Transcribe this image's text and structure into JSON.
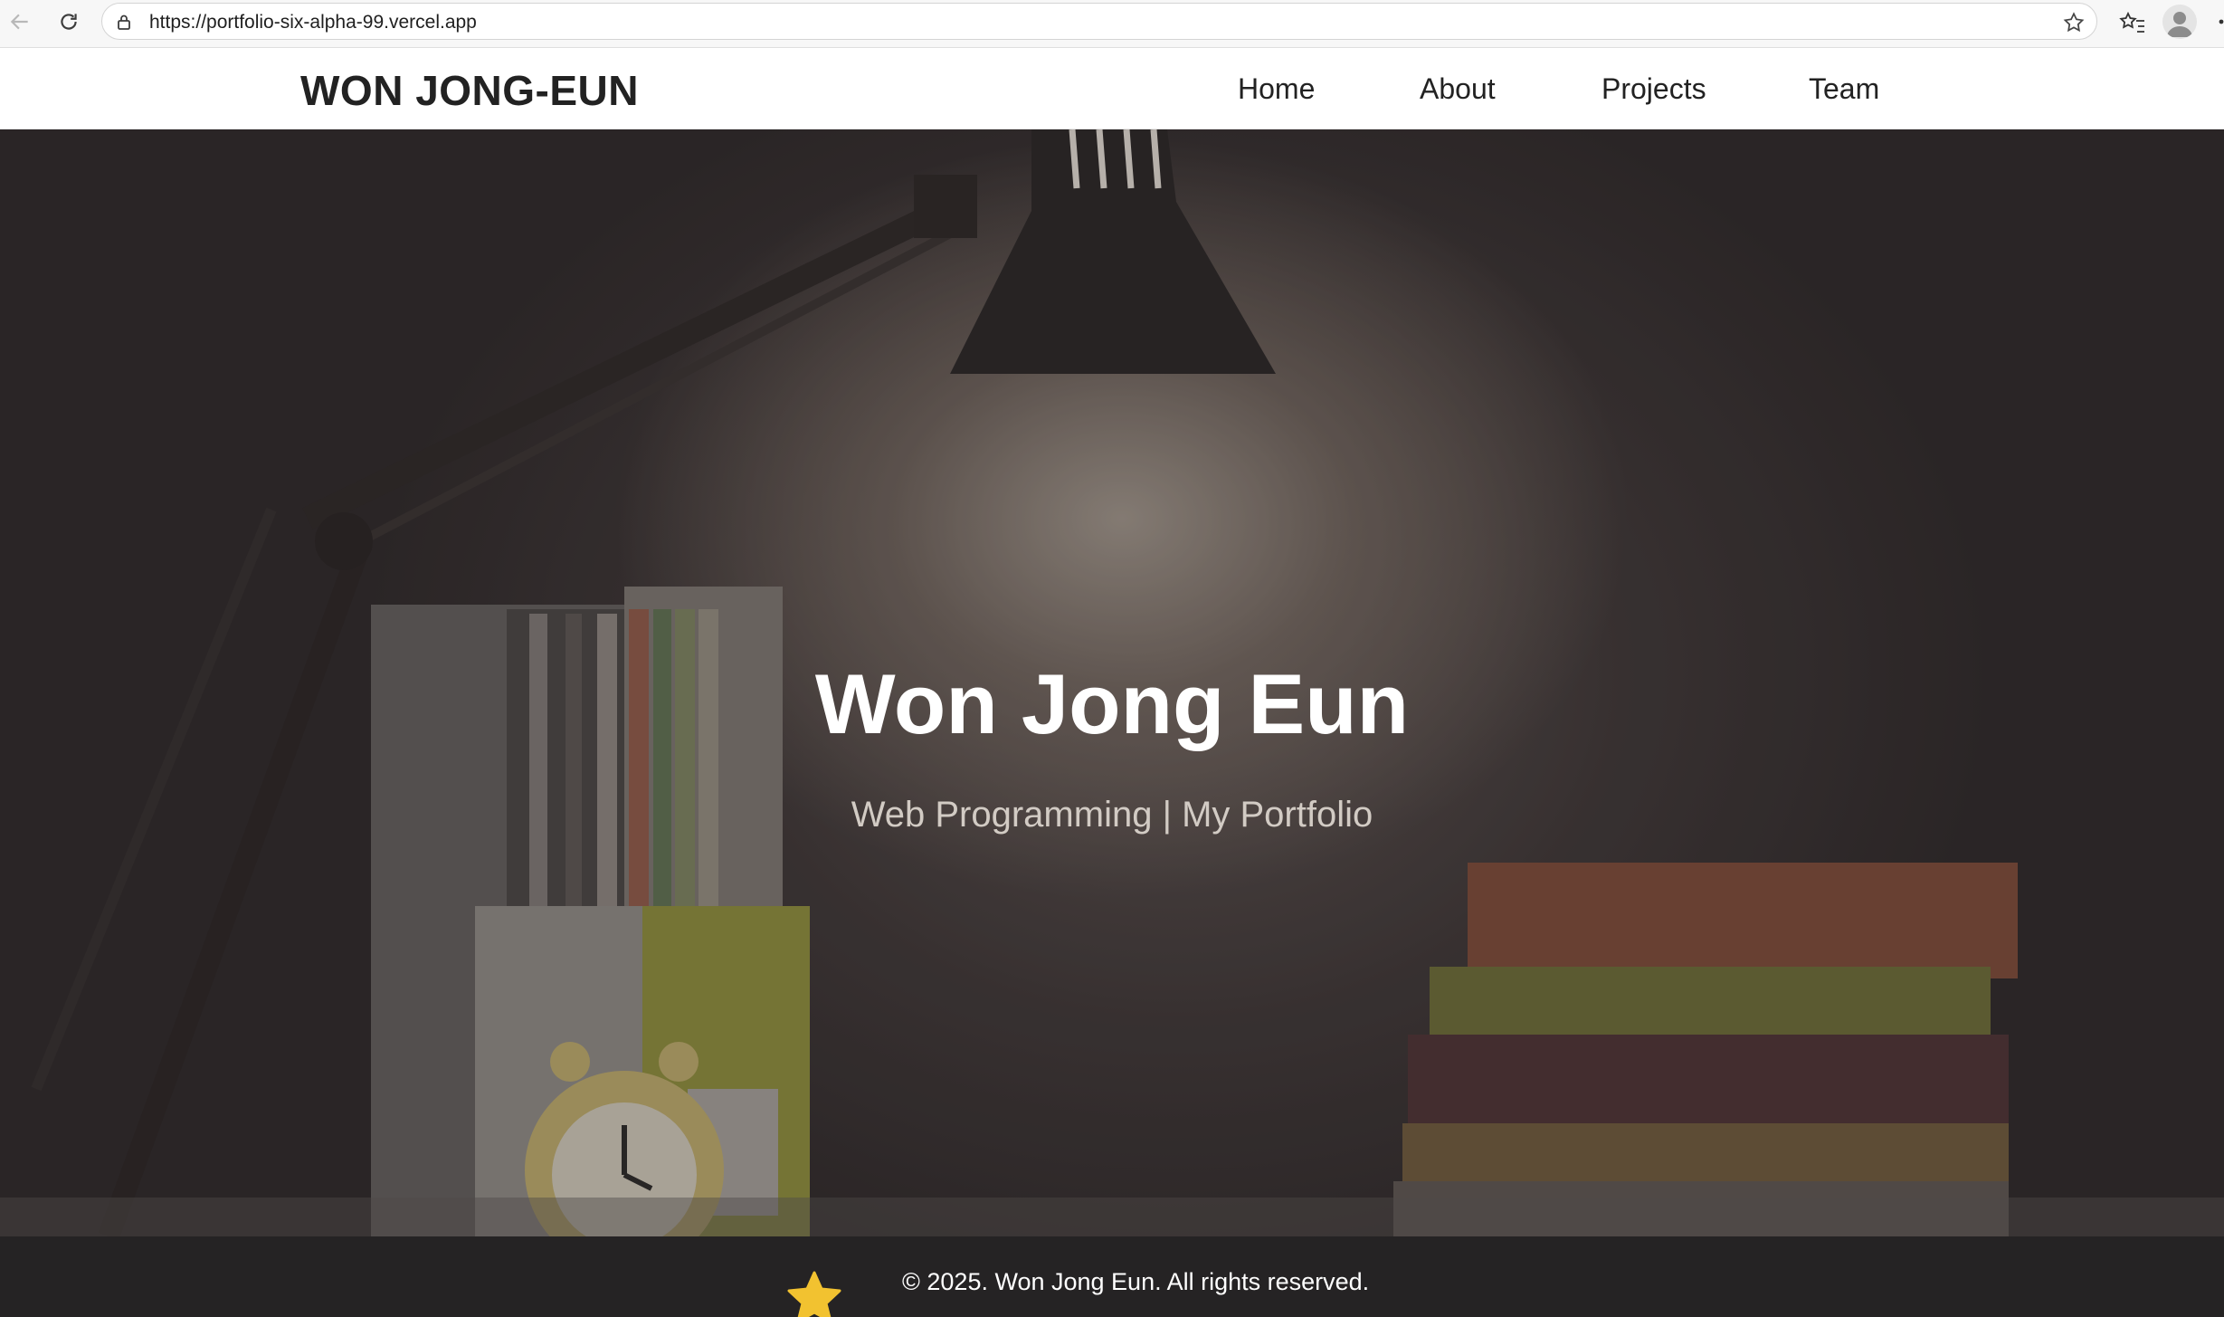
{
  "browser": {
    "url": "https://portfolio-six-alpha-99.vercel.app"
  },
  "header": {
    "brand": "WON JONG-EUN",
    "nav": [
      "Home",
      "About",
      "Projects",
      "Team"
    ]
  },
  "hero": {
    "title": "Won Jong Eun",
    "subtitle": "Web Programming | My Portfolio"
  },
  "footer": {
    "text": "© 2025. Won Jong Eun. All rights reserved."
  },
  "colors": {
    "header_bg": "#ffffff",
    "text_dark": "#222222",
    "footer_bg": "#252324",
    "hero_title": "#ffffff",
    "hero_subtitle": "#d2cbc4",
    "star": "#f2c230"
  }
}
